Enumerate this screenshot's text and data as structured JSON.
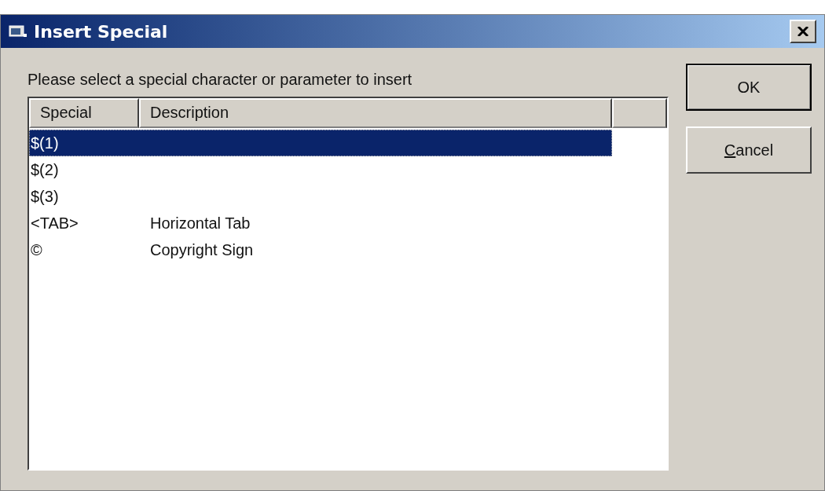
{
  "window": {
    "title": "Insert Special"
  },
  "prompt": "Please select a special character or parameter to insert",
  "list": {
    "columns": [
      "Special",
      "Description"
    ],
    "rows": [
      {
        "special": "$(1)",
        "selected": true
      },
      {
        "special": "$(2)",
        "selected": false
      },
      {
        "special": "$(3)",
        "selected": false
      },
      {
        "special": "<TAB>",
        "description": "Horizontal Tab",
        "selected": false
      },
      {
        "special": "©",
        "description": "Copyright Sign",
        "selected": false
      }
    ]
  },
  "buttons": [
    {
      "label": "OK",
      "default": true,
      "first_letter_underlined": false
    },
    {
      "label": "Cancel",
      "default": false,
      "first_letter_underlined": true
    }
  ]
}
